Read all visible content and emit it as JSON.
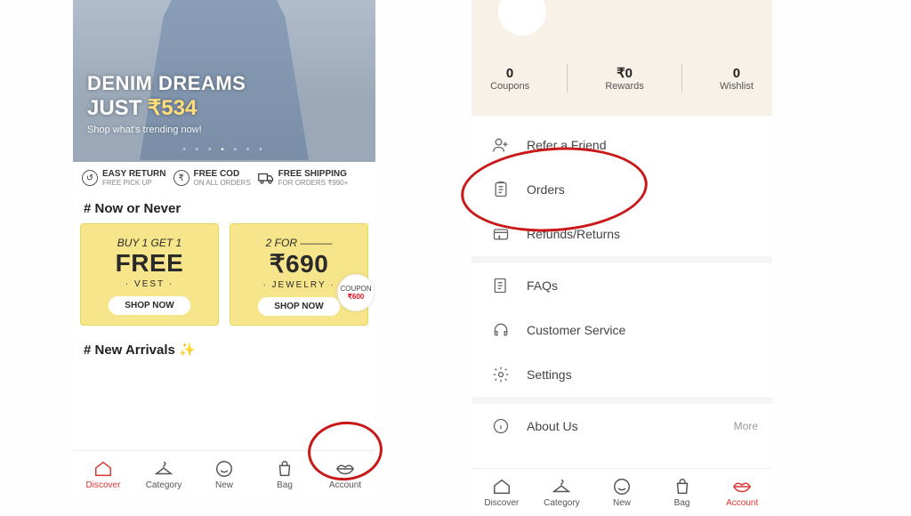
{
  "left": {
    "hero": {
      "title": "DENIM DREAMS",
      "price_prefix": "JUST ",
      "price": "₹534",
      "sub": "Shop what's trending now!"
    },
    "benefits": [
      {
        "icon": "return-icon",
        "t1": "EASY RETURN",
        "t2": "FREE PICK UP"
      },
      {
        "icon": "cod-icon",
        "t1": "FREE COD",
        "t2": "ON ALL ORDERS"
      },
      {
        "icon": "truck-icon",
        "t1": "FREE SHIPPING",
        "t2": "FOR ORDERS ₹990+"
      }
    ],
    "section1": "# Now or Never",
    "offers": [
      {
        "line1": "BUY 1 GET 1",
        "big": "FREE",
        "cat": "· VEST ·",
        "btn": "SHOP NOW"
      },
      {
        "line1": "2 FOR ———",
        "big": "₹690",
        "cat": "· JEWELRY ·",
        "btn": "SHOP NOW",
        "coupon_label": "COUPON",
        "coupon_value": "₹600"
      }
    ],
    "section2": "# New Arrivals ✨",
    "nav": [
      {
        "label": "Discover",
        "active": true
      },
      {
        "label": "Category"
      },
      {
        "label": "New"
      },
      {
        "label": "Bag"
      },
      {
        "label": "Account"
      }
    ]
  },
  "right": {
    "stats": [
      {
        "v": "0",
        "l": "Coupons"
      },
      {
        "v": "₹0",
        "l": "Rewards"
      },
      {
        "v": "0",
        "l": "Wishlist"
      }
    ],
    "menu": [
      {
        "label": "Refer a Friend",
        "icon": "refer-icon"
      },
      {
        "label": "Orders",
        "icon": "orders-icon"
      },
      {
        "label": "Refunds/Returns",
        "icon": "refund-icon"
      },
      {
        "sep": true
      },
      {
        "label": "FAQs",
        "icon": "faq-icon"
      },
      {
        "label": "Customer Service",
        "icon": "headset-icon"
      },
      {
        "label": "Settings",
        "icon": "gear-icon"
      },
      {
        "sep": true
      },
      {
        "label": "About Us",
        "icon": "info-icon",
        "more": "More"
      }
    ],
    "nav": [
      {
        "label": "Discover"
      },
      {
        "label": "Category"
      },
      {
        "label": "New"
      },
      {
        "label": "Bag"
      },
      {
        "label": "Account",
        "active": true
      }
    ]
  }
}
